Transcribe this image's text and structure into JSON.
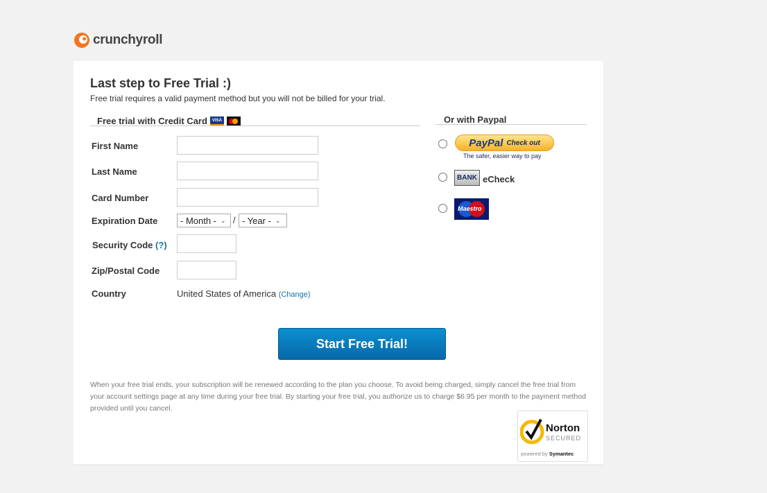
{
  "brand": {
    "name": "crunchyroll",
    "color": "#f47521"
  },
  "header": {
    "title": "Last step to Free Trial :)",
    "subtitle": "Free trial requires a valid payment method but you will not be billed for your trial."
  },
  "credit": {
    "heading": "Free trial with Credit Card",
    "card_logos": [
      "VISA",
      "MasterCard"
    ],
    "fields": {
      "first_name": "First Name",
      "last_name": "Last Name",
      "card_number": "Card Number",
      "expiration": "Expiration Date",
      "month": "- Month -",
      "year": "- Year -",
      "separator": "/",
      "security": "Security Code",
      "security_help": "(?)",
      "zip": "Zip/Postal Code",
      "country": "Country",
      "country_value": "United States of America",
      "change": "(Change)"
    }
  },
  "paypal": {
    "heading": "Or with Paypal",
    "paypal_logo": "PayPal",
    "paypal_checkout": "Check out",
    "paypal_tagline": "The safer, easier way to pay",
    "bank_badge": "BANK",
    "echeck": "eCheck",
    "maestro": "Maestro"
  },
  "submit": {
    "label": "Start Free Trial!",
    "color": "#0a7fc0"
  },
  "legal": "When your free trial ends, your subscription will be renewed according to the plan you choose. To avoid being charged, simply cancel the free trial from your account settings page at any time during your free trial. By starting your free trial, you authorize us to charge $6.95 per month to the payment method provided until you cancel.",
  "norton": {
    "name": "Norton",
    "secured": "SECURED",
    "powered": "powered by",
    "symantec": "Symantec"
  }
}
